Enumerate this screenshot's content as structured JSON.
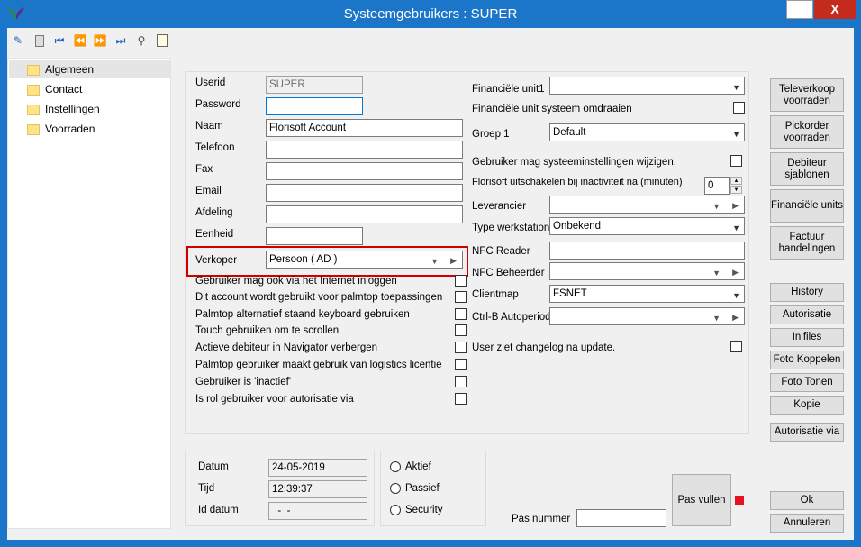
{
  "window": {
    "title": "Systeemgebruikers : SUPER",
    "help_label": "?",
    "close_label": "X"
  },
  "toolbar": {
    "icons": [
      "new-icon",
      "delete-icon",
      "first-icon",
      "prev-icon",
      "next-icon",
      "last-icon",
      "search-icon",
      "notes-icon"
    ]
  },
  "tree": {
    "items": [
      {
        "label": "Algemeen"
      },
      {
        "label": "Contact"
      },
      {
        "label": "Instellingen"
      },
      {
        "label": "Voorraden"
      }
    ]
  },
  "form": {
    "userid": {
      "label": "Userid",
      "value": "SUPER"
    },
    "password": {
      "label": "Password",
      "value": ""
    },
    "naam": {
      "label": "Naam",
      "value": "Florisoft Account"
    },
    "telefoon": {
      "label": "Telefoon",
      "value": ""
    },
    "fax": {
      "label": "Fax",
      "value": ""
    },
    "email": {
      "label": "Email",
      "value": ""
    },
    "afdeling": {
      "label": "Afdeling",
      "value": ""
    },
    "eenheid": {
      "label": "Eenheid",
      "value": ""
    },
    "verkoper": {
      "label": "Verkoper",
      "value": "Persoon  ( AD )"
    },
    "checks": [
      {
        "label": "Gebruiker mag ook via het Internet inloggen"
      },
      {
        "label": "Dit account wordt gebruikt voor palmtop toepassingen"
      },
      {
        "label": "Palmtop alternatief staand keyboard gebruiken"
      },
      {
        "label": "Touch gebruiken om te scrollen"
      },
      {
        "label": "Actieve debiteur in Navigator verbergen"
      },
      {
        "label": "Palmtop gebruiker maakt gebruik van logistics licentie"
      },
      {
        "label": "Gebruiker is 'inactief'"
      },
      {
        "label": "Is rol gebruiker voor autorisatie via"
      }
    ]
  },
  "right": {
    "fin_unit1": {
      "label": "Financiële unit1",
      "value": ""
    },
    "fin_omdraaien": {
      "label": "Financiële unit systeem omdraaien"
    },
    "groep1": {
      "label": "Groep 1",
      "value": "Default"
    },
    "sys_wijzigen": {
      "label": "Gebruiker mag systeeminstellingen wijzigen."
    },
    "uitschakelen": {
      "label": "Florisoft uitschakelen bij inactiviteit na (minuten)",
      "value": "0"
    },
    "leverancier": {
      "label": "Leverancier",
      "value": ""
    },
    "type_werkstation": {
      "label": "Type werkstation",
      "value": "Onbekend"
    },
    "nfc_reader": {
      "label": "NFC Reader",
      "value": ""
    },
    "nfc_beheerder": {
      "label": "NFC Beheerder",
      "value": ""
    },
    "clientmap": {
      "label": "Clientmap",
      "value": "FSNET"
    },
    "ctrlb": {
      "label": "Ctrl-B Autoperiode",
      "value": ""
    },
    "changelog": {
      "label": "User ziet changelog na update."
    }
  },
  "status": {
    "datum": {
      "label": "Datum",
      "value": "24-05-2019"
    },
    "tijd": {
      "label": "Tijd",
      "value": "12:39:37"
    },
    "id_datum": {
      "label": "Id datum",
      "value": "  -  -"
    },
    "radios": [
      {
        "label": "Aktief"
      },
      {
        "label": "Passief"
      },
      {
        "label": "Security"
      }
    ],
    "pas_nummer": {
      "label": "Pas nummer",
      "value": ""
    },
    "pas_vullen": "Pas vullen"
  },
  "side_buttons": [
    {
      "label": "Televerkoop voorraden"
    },
    {
      "label": "Pickorder voorraden"
    },
    {
      "label": "Debiteur sjablonen"
    },
    {
      "label": "Financiële units"
    },
    {
      "label": "Factuur handelingen"
    },
    {
      "label": "History"
    },
    {
      "label": "Autorisatie"
    },
    {
      "label": "Inifiles"
    },
    {
      "label": "Foto Koppelen"
    },
    {
      "label": "Foto Tonen"
    },
    {
      "label": "Kopie"
    },
    {
      "label": "Autorisatie via"
    }
  ],
  "footer": {
    "ok": "Ok",
    "cancel": "Annuleren"
  },
  "colors": {
    "titlebar": "#1b76c9",
    "highlight": "#d00000",
    "status_indicator": "#e81123"
  }
}
